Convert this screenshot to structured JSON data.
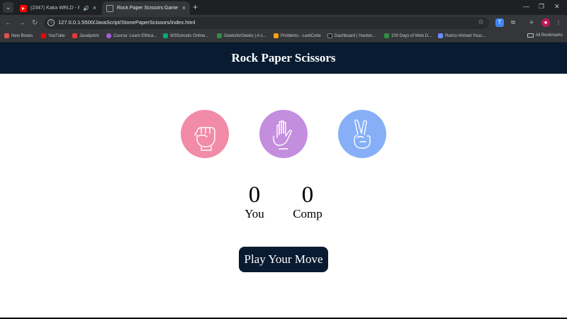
{
  "browser": {
    "tabs": [
      {
        "title": "(2347) Kaka WRLD - Radhu",
        "favicon": "youtube-icon",
        "audio": true
      },
      {
        "title": "Rock Paper Scissors Game",
        "favicon": "globe-icon",
        "active": true
      }
    ],
    "address": "127.0.0.1:5500/JavaScript/StonePaperScissors/index.html",
    "bookmarks": [
      {
        "label": "New Books",
        "color": "#d9534f"
      },
      {
        "label": "YouTube",
        "color": "#ff0000"
      },
      {
        "label": "Javatpoint",
        "color": "#e53935"
      },
      {
        "label": "Course: Learn Ethica...",
        "color": "#a35ed8"
      },
      {
        "label": "W3Schools Online...",
        "color": "#04aa6d"
      },
      {
        "label": "GeeksforGeeks | A c...",
        "color": "#2f8d46"
      },
      {
        "label": "Problems - LeetCode",
        "color": "#ffa116"
      },
      {
        "label": "Dashboard | Hacker...",
        "color": "#1f1f1f"
      },
      {
        "label": "100 Days of Web D...",
        "color": "#2f8d46"
      },
      {
        "label": "Ramzi Ahmed Yous...",
        "color": "#6b8cff"
      }
    ],
    "all_bookmarks": "All Bookmarks"
  },
  "page": {
    "title": "Rock Paper Scissors",
    "choices": [
      {
        "id": "rock",
        "icon": "fist-icon",
        "color": "#f18ba8"
      },
      {
        "id": "paper",
        "icon": "open-hand-icon",
        "color": "#c38ede"
      },
      {
        "id": "scissors",
        "icon": "victory-hand-icon",
        "color": "#86aff8"
      }
    ],
    "scores": {
      "user_score": "0",
      "user_label": "You",
      "comp_score": "0",
      "comp_label": "Comp"
    },
    "message": "Play Your Move",
    "colors": {
      "header": "#081b31",
      "button": "#081b31"
    }
  }
}
